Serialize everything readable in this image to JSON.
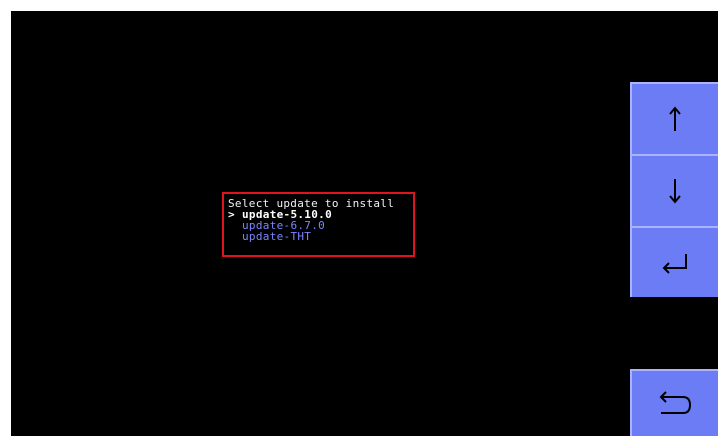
{
  "menu": {
    "title": "Select update to install",
    "cursor": ">",
    "items": [
      {
        "label": "update-5.10.0",
        "selected": true
      },
      {
        "label": "update-6.7.0",
        "selected": false
      },
      {
        "label": "update-THT",
        "selected": false
      }
    ]
  },
  "buttons": {
    "up": "arrow-up-icon",
    "down": "arrow-down-icon",
    "enter": "enter-icon",
    "back": "back-icon"
  },
  "colors": {
    "background": "#000000",
    "highlight_border": "#e0141e",
    "button": "#6b7cf5",
    "selected_text": "#ffffff",
    "item_text": "#7b86ff"
  }
}
